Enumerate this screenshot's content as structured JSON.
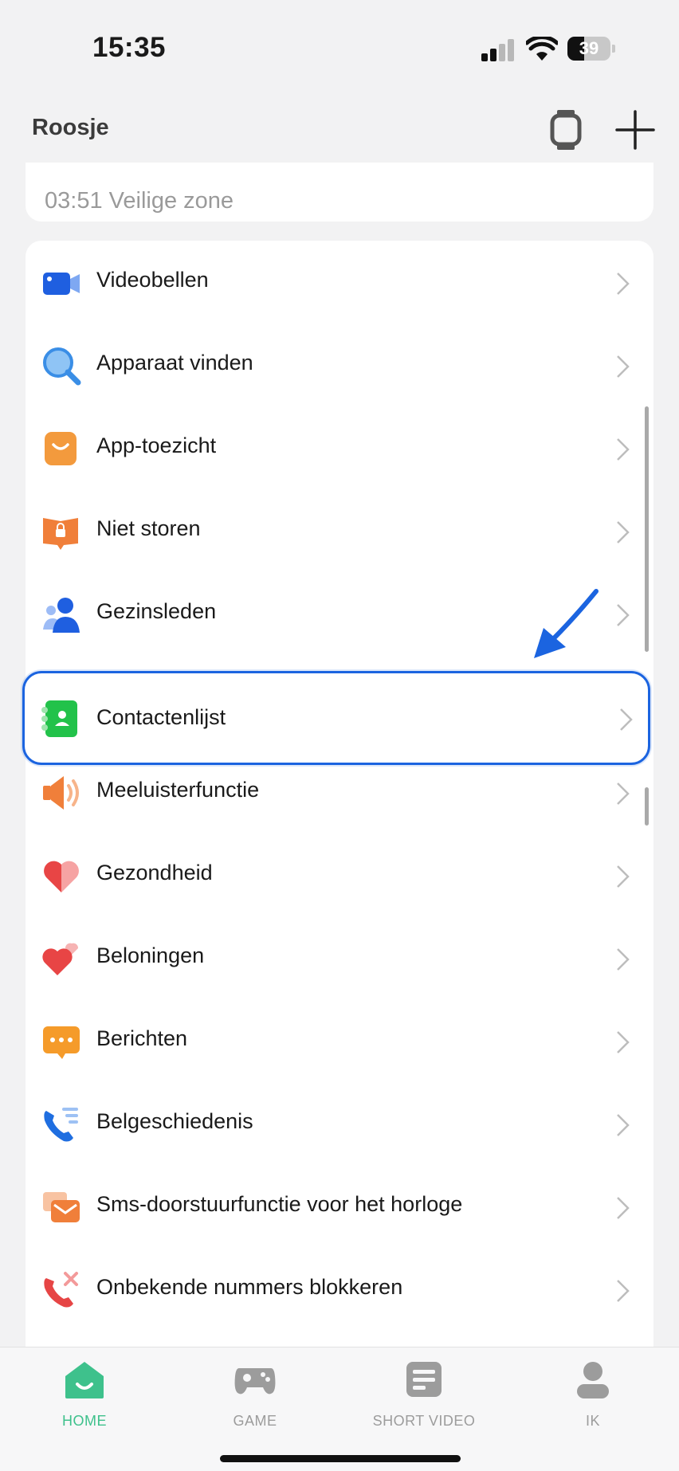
{
  "status_bar": {
    "time": "15:35",
    "battery": "39",
    "battery_level": 0.39
  },
  "header": {
    "title": "Roosje"
  },
  "top_card": {
    "text": "03:51 Veilige zone"
  },
  "menu": {
    "items": [
      {
        "label": "Videobellen",
        "icon": "video-call-icon"
      },
      {
        "label": "Apparaat vinden",
        "icon": "find-device-icon"
      },
      {
        "label": "App-toezicht",
        "icon": "app-supervision-icon"
      },
      {
        "label": "Niet storen",
        "icon": "do-not-disturb-icon"
      },
      {
        "label": "Gezinsleden",
        "icon": "family-members-icon"
      },
      {
        "label": "Contactenlijst",
        "icon": "contacts-icon"
      },
      {
        "label": "Meeluisterfunctie",
        "icon": "listen-in-icon"
      },
      {
        "label": "Gezondheid",
        "icon": "health-icon"
      },
      {
        "label": "Beloningen",
        "icon": "rewards-icon"
      },
      {
        "label": "Berichten",
        "icon": "messages-icon"
      },
      {
        "label": "Belgeschiedenis",
        "icon": "call-history-icon"
      },
      {
        "label": "Sms-doorstuurfunctie voor het horloge",
        "icon": "sms-forward-icon"
      },
      {
        "label": "Onbekende nummers blokkeren",
        "icon": "block-numbers-icon"
      }
    ]
  },
  "tabs": [
    {
      "label": "HOME",
      "icon": "home-icon",
      "active": true
    },
    {
      "label": "GAME",
      "icon": "gamepad-icon",
      "active": false
    },
    {
      "label": "SHORT VIDEO",
      "icon": "short-video-icon",
      "active": false
    },
    {
      "label": "IK",
      "icon": "profile-icon",
      "active": false
    }
  ],
  "colors": {
    "accent": "#3ec18c",
    "highlight": "#1b64e0"
  }
}
